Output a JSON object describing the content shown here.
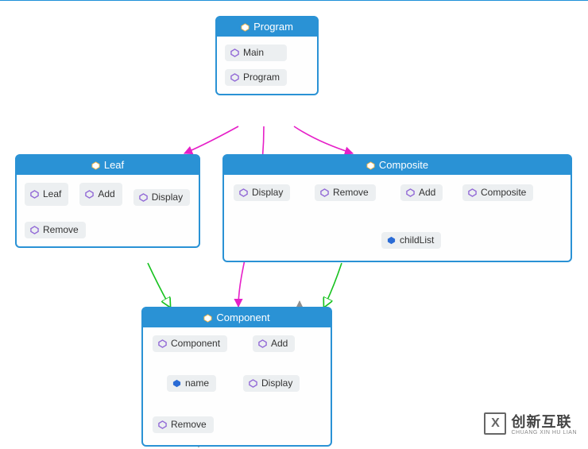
{
  "boxes": {
    "program": {
      "title": "Program",
      "items": [
        "Main",
        "Program"
      ]
    },
    "leaf": {
      "title": "Leaf",
      "items": [
        "Leaf",
        "Add",
        "Display",
        "Remove"
      ]
    },
    "composite": {
      "title": "Composite",
      "items": [
        "Display",
        "Remove",
        "Add",
        "Composite"
      ],
      "child": "childList"
    },
    "component": {
      "title": "Component",
      "items": [
        "Component",
        "Add",
        "Display",
        "Remove"
      ],
      "child": "name"
    }
  },
  "logo": {
    "main": "创新互联",
    "sub": "CHUANG XIN HU LIAN"
  },
  "colors": {
    "border": "#2a92d5",
    "magenta": "#e61fc8",
    "green": "#17c21f",
    "blue": "#2a92d5",
    "gray": "#8f8f8f"
  }
}
